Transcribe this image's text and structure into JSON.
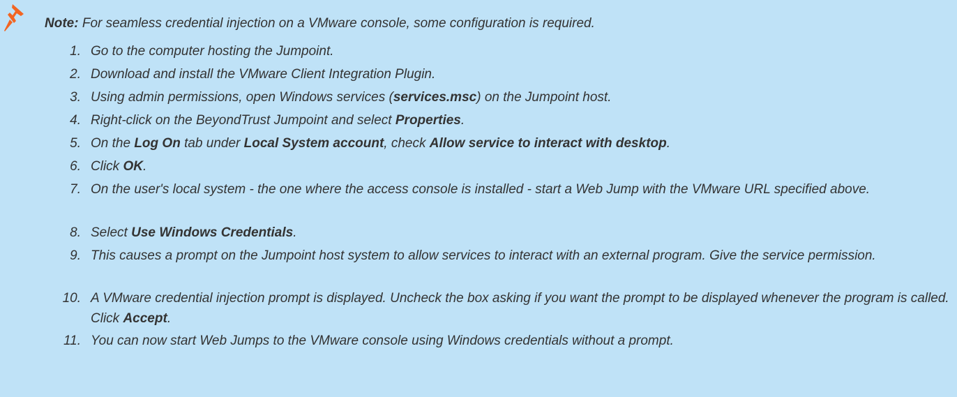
{
  "note": {
    "icon": "pushpin-icon",
    "icon_color": "#f26522",
    "label": "Note:",
    "text": " For seamless credential injection on a VMware console, some configuration is required."
  },
  "steps": [
    {
      "num": "1.",
      "parts": [
        {
          "t": "Go to the computer hosting the Jumpoint."
        }
      ]
    },
    {
      "num": "2.",
      "parts": [
        {
          "t": "Download and install the VMware Client Integration Plugin."
        }
      ]
    },
    {
      "num": "3.",
      "parts": [
        {
          "t": "Using admin permissions, open Windows services ("
        },
        {
          "t": "services.msc",
          "b": true
        },
        {
          "t": ") on the Jumpoint host."
        }
      ]
    },
    {
      "num": "4.",
      "parts": [
        {
          "t": "Right-click on the BeyondTrust Jumpoint and select "
        },
        {
          "t": "Properties",
          "b": true
        },
        {
          "t": "."
        }
      ]
    },
    {
      "num": "5.",
      "parts": [
        {
          "t": "On the "
        },
        {
          "t": "Log On",
          "b": true
        },
        {
          "t": " tab under "
        },
        {
          "t": "Local System account",
          "b": true
        },
        {
          "t": ", check "
        },
        {
          "t": "Allow service to interact with desktop",
          "b": true
        },
        {
          "t": "."
        }
      ]
    },
    {
      "num": "6.",
      "parts": [
        {
          "t": "Click "
        },
        {
          "t": "OK",
          "b": true
        },
        {
          "t": "."
        }
      ]
    },
    {
      "num": "7.",
      "parts": [
        {
          "t": "On the user's local system - the one where the access console is installed - start a Web Jump with the VMware URL specified above."
        }
      ]
    },
    {
      "num": "8.",
      "parts": [
        {
          "t": "Select "
        },
        {
          "t": "Use Windows Credentials",
          "b": true
        },
        {
          "t": "."
        }
      ]
    },
    {
      "num": "9.",
      "parts": [
        {
          "t": "This causes a prompt on the Jumpoint host system to allow services to interact with an external program. Give the service permission."
        }
      ]
    },
    {
      "num": "10.",
      "parts": [
        {
          "t": "A VMware credential injection prompt is displayed. Uncheck the box asking if you want the prompt to be displayed whenever the program is called. Click "
        },
        {
          "t": "Accept",
          "b": true
        },
        {
          "t": "."
        }
      ]
    },
    {
      "num": "11.",
      "parts": [
        {
          "t": "You can now start Web Jumps to the VMware console using Windows credentials without a prompt."
        }
      ]
    }
  ]
}
